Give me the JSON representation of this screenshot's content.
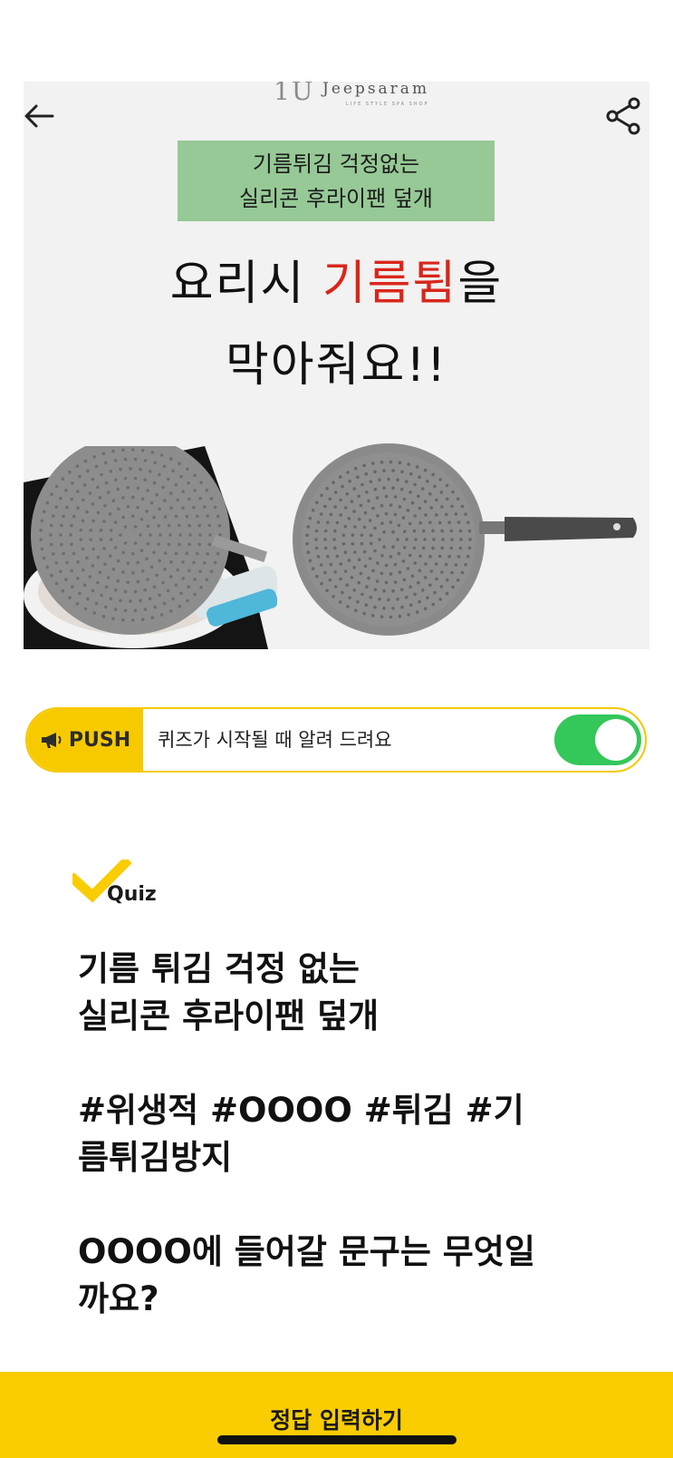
{
  "product_image": {
    "brand_mark": "1U",
    "brand_name": "Jeepsaram",
    "brand_sub": "LIFE STYLE SPA SHOP",
    "banner_line1": "기름튀김 걱정없는",
    "banner_line2": "실리콘 후라이팬 덮개",
    "headline_part1": "요리시 ",
    "headline_highlight": "기름튐",
    "headline_part2": "을",
    "headline_line2": "막아줘요!!"
  },
  "push": {
    "badge": "PUSH",
    "text": "퀴즈가 시작될 때 알려 드려요",
    "enabled": true
  },
  "quiz": {
    "label": "Quiz",
    "question": "기름 튀김 걱정 없는\n실리콘 후라이팬 덮개\n\n#위생적 #OOOO #튀김 #기\n름튀김방지\n\nOOOO에 들어갈 문구는 무엇일\n까요?"
  },
  "footer": {
    "submit_label": "정답 입력하기"
  },
  "colors": {
    "accent_yellow": "#f9cd00",
    "toggle_green": "#34c759",
    "banner_green": "#96c996",
    "highlight_red": "#d9261c"
  }
}
